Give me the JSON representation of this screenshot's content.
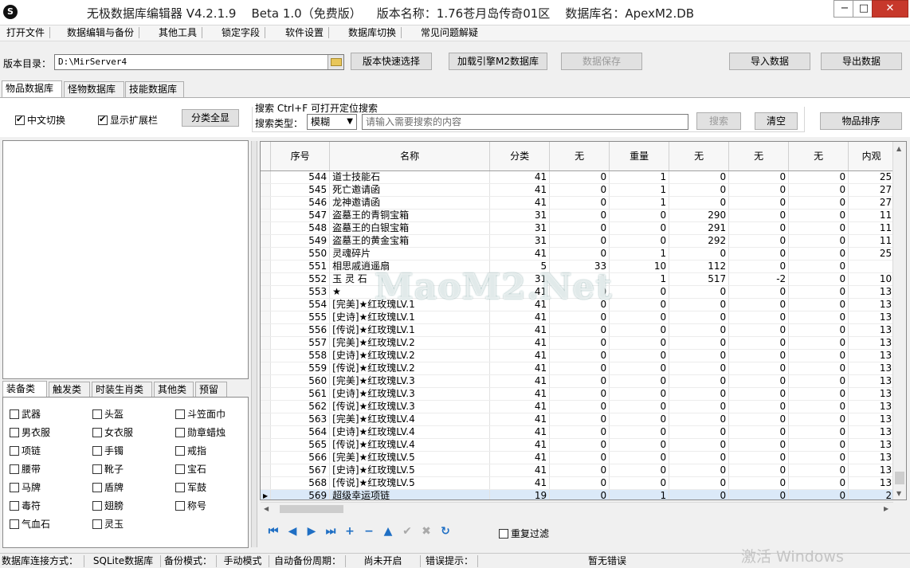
{
  "window": {
    "title": "无极数据库编辑器 V4.2.1.9    Beta 1.0（免费版）    版本名称：1.76苍月岛传奇01区    数据库名：ApexM2.DB",
    "min": "−",
    "max": "□",
    "close": "✕"
  },
  "menu": [
    "打开文件",
    "数据编辑与备份",
    "其他工具",
    "锁定字段",
    "软件设置",
    "数据库切换",
    "常见问题解疑"
  ],
  "toolbar": {
    "version_dir_label": "版本目录：",
    "version_dir_value": "D:\\MirServer4",
    "quick_select": "版本快速选择",
    "load_engine": "加载引擎M2数据库",
    "save_data": "数据保存",
    "import": "导入数据",
    "export": "导出数据"
  },
  "tabs": [
    "物品数据库",
    "怪物数据库",
    "技能数据库"
  ],
  "options": {
    "chinese_switch": "中文切换",
    "show_ext": "显示扩展栏",
    "show_all": "分类全显"
  },
  "search": {
    "title": "搜索   Ctrl+F 可打开定位搜索",
    "type_label": "搜索类型：",
    "type_value": "模糊",
    "placeholder": "请输入需要搜索的内容",
    "search_btn": "搜索",
    "clear_btn": "清空",
    "sort_btn": "物品排序"
  },
  "category_tabs": [
    "装备类",
    "触发类",
    "时装生肖类",
    "其他类",
    "预留"
  ],
  "categories": [
    [
      "武器",
      "头盔",
      "斗笠面巾"
    ],
    [
      "男衣服",
      "女衣服",
      "勋章蜡烛"
    ],
    [
      "项链",
      "手镯",
      "戒指"
    ],
    [
      "腰带",
      "靴子",
      "宝石"
    ],
    [
      "马牌",
      "盾牌",
      "军鼓"
    ],
    [
      "毒符",
      "翅膀",
      "称号"
    ],
    [
      "气血石",
      "灵玉",
      ""
    ]
  ],
  "grid": {
    "columns": [
      "序号",
      "名称",
      "分类",
      "无",
      "重量",
      "无",
      "无",
      "无",
      "内观"
    ],
    "rows": [
      [
        "544",
        "道士技能石",
        "41",
        "0",
        "1",
        "0",
        "0",
        "0",
        "25"
      ],
      [
        "545",
        "死亡邀请函",
        "41",
        "0",
        "1",
        "0",
        "0",
        "0",
        "27"
      ],
      [
        "546",
        "龙神邀请函",
        "41",
        "0",
        "1",
        "0",
        "0",
        "0",
        "27"
      ],
      [
        "547",
        "盗墓王的青铜宝箱",
        "31",
        "0",
        "0",
        "290",
        "0",
        "0",
        "11"
      ],
      [
        "548",
        "盗墓王的白银宝箱",
        "31",
        "0",
        "0",
        "291",
        "0",
        "0",
        "11"
      ],
      [
        "549",
        "盗墓王的黄金宝箱",
        "31",
        "0",
        "0",
        "292",
        "0",
        "0",
        "11"
      ],
      [
        "550",
        "灵魂碎片",
        "41",
        "0",
        "1",
        "0",
        "0",
        "0",
        "25"
      ],
      [
        "551",
        "相思戚逍遥扇",
        "5",
        "33",
        "10",
        "112",
        "0",
        "0",
        ""
      ],
      [
        "552",
        "玉 灵 石",
        "31",
        "1",
        "1",
        "517",
        "-2",
        "0",
        "10"
      ],
      [
        "553",
        "★",
        "41",
        "0",
        "0",
        "0",
        "0",
        "0",
        "13"
      ],
      [
        "554",
        "[完美]★红玫瑰LV.1",
        "41",
        "0",
        "0",
        "0",
        "0",
        "0",
        "13"
      ],
      [
        "555",
        "[史诗]★红玫瑰LV.1",
        "41",
        "0",
        "0",
        "0",
        "0",
        "0",
        "13"
      ],
      [
        "556",
        "[传说]★红玫瑰LV.1",
        "41",
        "0",
        "0",
        "0",
        "0",
        "0",
        "13"
      ],
      [
        "557",
        "[完美]★红玫瑰LV.2",
        "41",
        "0",
        "0",
        "0",
        "0",
        "0",
        "13"
      ],
      [
        "558",
        "[史诗]★红玫瑰LV.2",
        "41",
        "0",
        "0",
        "0",
        "0",
        "0",
        "13"
      ],
      [
        "559",
        "[传说]★红玫瑰LV.2",
        "41",
        "0",
        "0",
        "0",
        "0",
        "0",
        "13"
      ],
      [
        "560",
        "[完美]★红玫瑰LV.3",
        "41",
        "0",
        "0",
        "0",
        "0",
        "0",
        "13"
      ],
      [
        "561",
        "[史诗]★红玫瑰LV.3",
        "41",
        "0",
        "0",
        "0",
        "0",
        "0",
        "13"
      ],
      [
        "562",
        "[传说]★红玫瑰LV.3",
        "41",
        "0",
        "0",
        "0",
        "0",
        "0",
        "13"
      ],
      [
        "563",
        "[完美]★红玫瑰LV.4",
        "41",
        "0",
        "0",
        "0",
        "0",
        "0",
        "13"
      ],
      [
        "564",
        "[史诗]★红玫瑰LV.4",
        "41",
        "0",
        "0",
        "0",
        "0",
        "0",
        "13"
      ],
      [
        "565",
        "[传说]★红玫瑰LV.4",
        "41",
        "0",
        "0",
        "0",
        "0",
        "0",
        "13"
      ],
      [
        "566",
        "[完美]★红玫瑰LV.5",
        "41",
        "0",
        "0",
        "0",
        "0",
        "0",
        "13"
      ],
      [
        "567",
        "[史诗]★红玫瑰LV.5",
        "41",
        "0",
        "0",
        "0",
        "0",
        "0",
        "13"
      ],
      [
        "568",
        "[传说]★红玫瑰LV.5",
        "41",
        "0",
        "0",
        "0",
        "0",
        "0",
        "13"
      ],
      [
        "569",
        "超级幸运项链",
        "19",
        "0",
        "1",
        "0",
        "0",
        "0",
        "2"
      ]
    ],
    "selected_row": 25
  },
  "nav": {
    "first": "⏮",
    "prev": "◀",
    "next": "▶",
    "last": "⏭",
    "add": "+",
    "remove": "−",
    "up": "▲",
    "post": "✔",
    "cancel": "✖",
    "refresh": "↻",
    "dup_filter": "重复过滤"
  },
  "status": {
    "conn_label": "数据库连接方式：",
    "conn_value": "SQLite数据库",
    "backup_label": "备份模式：",
    "backup_value": "手动模式",
    "auto_label": "自动备份周期：",
    "auto_value": "尚未开启",
    "error_label": "错误提示：",
    "error_value": "暂无错误"
  },
  "watermarks": {
    "activate": "激活 Windows",
    "site": "MaoM2.Net"
  }
}
